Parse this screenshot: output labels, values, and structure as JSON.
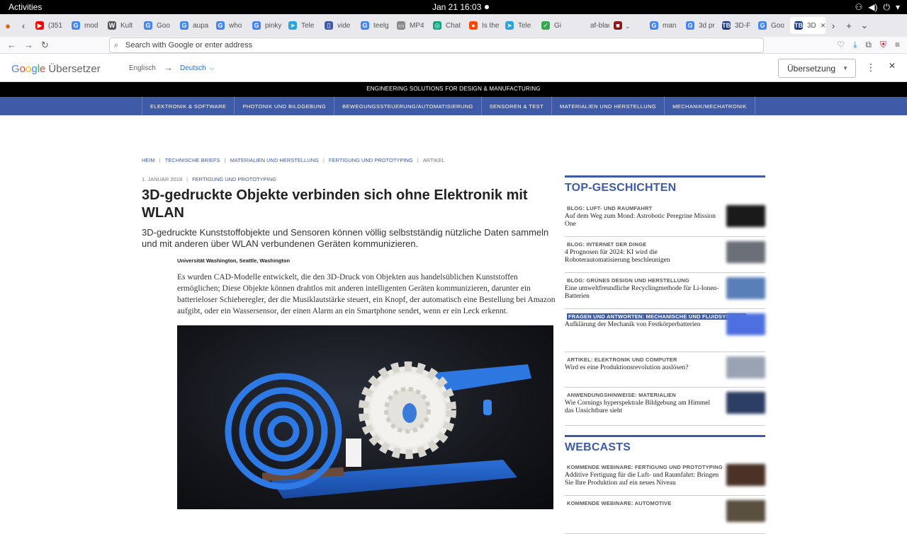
{
  "os": {
    "activities": "Activities",
    "clock": "Jan 21  16:03"
  },
  "tabs": [
    {
      "label": "(351",
      "color": "#ff0000",
      "glyph": "▶"
    },
    {
      "label": "mod",
      "color": "#4285f4",
      "glyph": "G"
    },
    {
      "label": "Kult",
      "color": "#555555",
      "glyph": "W"
    },
    {
      "label": "Goo",
      "color": "#4285f4",
      "glyph": "G"
    },
    {
      "label": "aupa",
      "color": "#4285f4",
      "glyph": "G"
    },
    {
      "label": "who",
      "color": "#4285f4",
      "glyph": "G"
    },
    {
      "label": "pinky",
      "color": "#4285f4",
      "glyph": "G"
    },
    {
      "label": "Tele",
      "color": "#2aa3df",
      "glyph": "➤"
    },
    {
      "label": "vide",
      "color": "#3f5aa6",
      "glyph": "▯"
    },
    {
      "label": "teelg",
      "color": "#4285f4",
      "glyph": "G"
    },
    {
      "label": "MP4",
      "color": "#888888",
      "glyph": "▭"
    },
    {
      "label": "Chat",
      "color": "#10a37f",
      "glyph": "◎"
    },
    {
      "label": "Is the",
      "color": "#ff4500",
      "glyph": "●"
    },
    {
      "label": "Tele",
      "color": "#2aa3df",
      "glyph": "➤"
    },
    {
      "label": "Gi",
      "color": "#34a853",
      "glyph": "✓"
    },
    {
      "label": "af-black",
      "color": "#e9e9ed",
      "glyph": ""
    },
    {
      "label": "„",
      "color": "#8b1a1a",
      "glyph": "■"
    },
    {
      "label": "man",
      "color": "#4285f4",
      "glyph": "G"
    },
    {
      "label": "3d pr",
      "color": "#4285f4",
      "glyph": "G"
    },
    {
      "label": "3D-F",
      "color": "#1a3a8a",
      "glyph": "TB"
    },
    {
      "label": "Goo",
      "color": "#4285f4",
      "glyph": "G"
    },
    {
      "label": "3D",
      "color": "#1a3a8a",
      "glyph": "TB",
      "active": true
    }
  ],
  "navbar": {
    "url_placeholder": "Search with Google or enter address"
  },
  "translate": {
    "logo_google": "Google",
    "logo_product": "Übersetzer",
    "source_lang": "Englisch",
    "target_lang": "Deutsch",
    "mode_button": "Übersetzung"
  },
  "site": {
    "tagline": "ENGINEERING SOLUTIONS FOR DESIGN & MANUFACTURING",
    "nav": [
      "ELEKTRONIK & SOFTWARE",
      "PHOTONIK UND BILDGEBUNG",
      "BEWEGUNGSSTEUERUNG/AUTOMATISIERUNG",
      "SENSOREN & TEST",
      "MATERIALIEN UND HERSTELLUNG",
      "MECHANIK/MECHATRONIK"
    ]
  },
  "breadcrumb": [
    "HEIM",
    "TECHNISCHE BRIEFS",
    "MATERIALIEN UND HERSTELLUNG",
    "FERTIGUNG UND PROTOTYPING",
    "ARTIKEL"
  ],
  "article": {
    "date": "1. JANUAR 2018",
    "category": "FERTIGUNG UND PROTOTYPING",
    "title": "3D-gedruckte Objekte verbinden sich ohne Elektronik mit WLAN",
    "subtitle": "3D-gedruckte Kunststoffobjekte und Sensoren können völlig selbstständig nützliche Daten sammeln und mit anderen über WLAN verbundenen Geräten kommunizieren.",
    "author": "Universität Washington, Seattle, Washington",
    "body": "Es wurden CAD-Modelle entwickelt, die den 3D-Druck von Objekten aus handelsüblichen Kunststoffen ermöglichen; Diese Objekte können drahtlos mit anderen intelligenten Geräten kommunizieren, darunter ein batterieloser Schieberegler, der die Musiklautstärke steuert, ein Knopf, der automatisch eine Bestellung bei Amazon aufgibt, oder ein Wassersensor, der einen Alarm an ein Smartphone sendet, wenn er ein Leck erkennt."
  },
  "sidebar": {
    "top_title": "TOP-GESCHICHTEN",
    "top_stories": [
      {
        "kicker": "BLOG: LUFT- UND RAUMFAHRT",
        "headline": "Auf dem Weg zum Mond: Astrobotic Peregrine Mission One",
        "thumb": "#1a1a1a"
      },
      {
        "kicker": "BLOG: INTERNET DER DINGE",
        "headline": "4 Prognosen für 2024: KI wird die Roboterautomatisierung beschleunigen",
        "thumb": "#6b6f78"
      },
      {
        "kicker": "BLOG: GRÜNES DESIGN UND HERSTELLUNG",
        "headline": "Eine umweltfreundliche Recyclingmethode für Li-Ionen-Batterien",
        "thumb": "#5a7fb8"
      },
      {
        "kicker": "FRAGEN UND ANTWORTEN: MECHANISCHE UND FLUIDSYSTEME",
        "headline": "Aufklärung der Mechanik von Festkörperbatterien",
        "thumb": "#4d6fe0",
        "highlight": true
      },
      {
        "kicker": "ARTIKEL: ELEKTRONIK UND COMPUTER",
        "headline": "Wird es eine Produktionsrevolution auslösen?",
        "thumb": "#9aa3b3"
      },
      {
        "kicker": "ANWENDUNGSHINWEISE: MATERIALIEN",
        "headline": "Wie Cornings hyperspektrale Bildgebung am Himmel das Unsichtbare sieht",
        "thumb": "#2c3e63"
      }
    ],
    "webcasts_title": "WEBCASTS",
    "webcasts": [
      {
        "kicker": "KOMMENDE WEBINARE: FERTIGUNG UND PROTOTYPING",
        "headline": "Additive Fertigung für die Luft- und Raumfahrt: Bringen Sie Ihre Produktion auf ein neues Niveau",
        "thumb": "#4a3226"
      },
      {
        "kicker": "KOMMENDE WEBINARE: AUTOMOTIVE",
        "headline": "",
        "thumb": "#5a5040"
      }
    ]
  },
  "colors": {
    "brand": "#3f5aa6",
    "tagline_bg": "#000000"
  }
}
